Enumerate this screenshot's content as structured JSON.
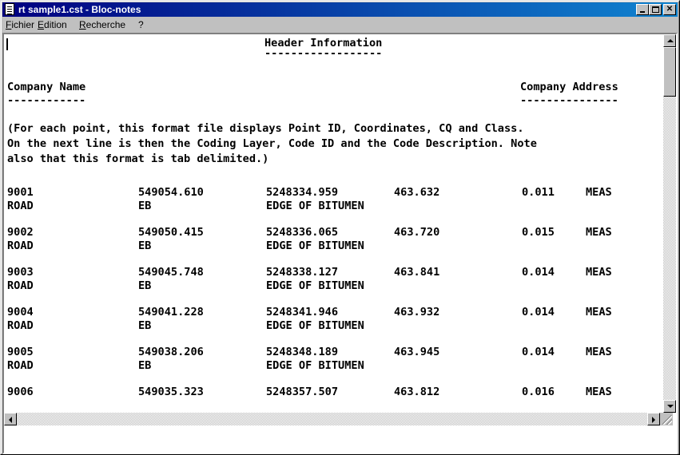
{
  "window": {
    "title": "rt sample1.cst - Bloc-notes"
  },
  "menu": [
    "Fichier",
    "Edition",
    "Recherche",
    "?"
  ],
  "document": {
    "header_title": "Header Information",
    "header_underline": "------------------",
    "company_name_label": "Company Name",
    "company_name_underline": "------------",
    "company_address_label": "Company Address",
    "company_address_underline": "---------------",
    "note_lines": [
      "(For each point, this format file displays Point ID, Coordinates, CQ and Class.",
      "On the next line is then the Coding Layer, Code ID and the Code Description. Note",
      "also that this format is tab delimited.)"
    ],
    "points": [
      {
        "id": "9001",
        "x": "549054.610",
        "y": "5248334.959",
        "z": "463.632",
        "cq": "0.011",
        "class": "MEAS",
        "layer": "ROAD",
        "code": "EB",
        "desc": "EDGE OF BITUMEN"
      },
      {
        "id": "9002",
        "x": "549050.415",
        "y": "5248336.065",
        "z": "463.720",
        "cq": "0.015",
        "class": "MEAS",
        "layer": "ROAD",
        "code": "EB",
        "desc": "EDGE OF BITUMEN"
      },
      {
        "id": "9003",
        "x": "549045.748",
        "y": "5248338.127",
        "z": "463.841",
        "cq": "0.014",
        "class": "MEAS",
        "layer": "ROAD",
        "code": "EB",
        "desc": "EDGE OF BITUMEN"
      },
      {
        "id": "9004",
        "x": "549041.228",
        "y": "5248341.946",
        "z": "463.932",
        "cq": "0.014",
        "class": "MEAS",
        "layer": "ROAD",
        "code": "EB",
        "desc": "EDGE OF BITUMEN"
      },
      {
        "id": "9005",
        "x": "549038.206",
        "y": "5248348.189",
        "z": "463.945",
        "cq": "0.014",
        "class": "MEAS",
        "layer": "ROAD",
        "code": "EB",
        "desc": "EDGE OF BITUMEN"
      },
      {
        "id": "9006",
        "x": "549035.323",
        "y": "5248357.507",
        "z": "463.812",
        "cq": "0.016",
        "class": "MEAS"
      }
    ]
  },
  "colors": {
    "titlebar_start": "#000080",
    "titlebar_end": "#1084d0",
    "face": "#c0c0c0"
  },
  "icons": [
    "notepad-icon",
    "minimize-icon",
    "maximize-icon",
    "close-icon",
    "scroll-up-icon",
    "scroll-down-icon",
    "scroll-left-icon",
    "scroll-right-icon",
    "size-grip-icon"
  ]
}
